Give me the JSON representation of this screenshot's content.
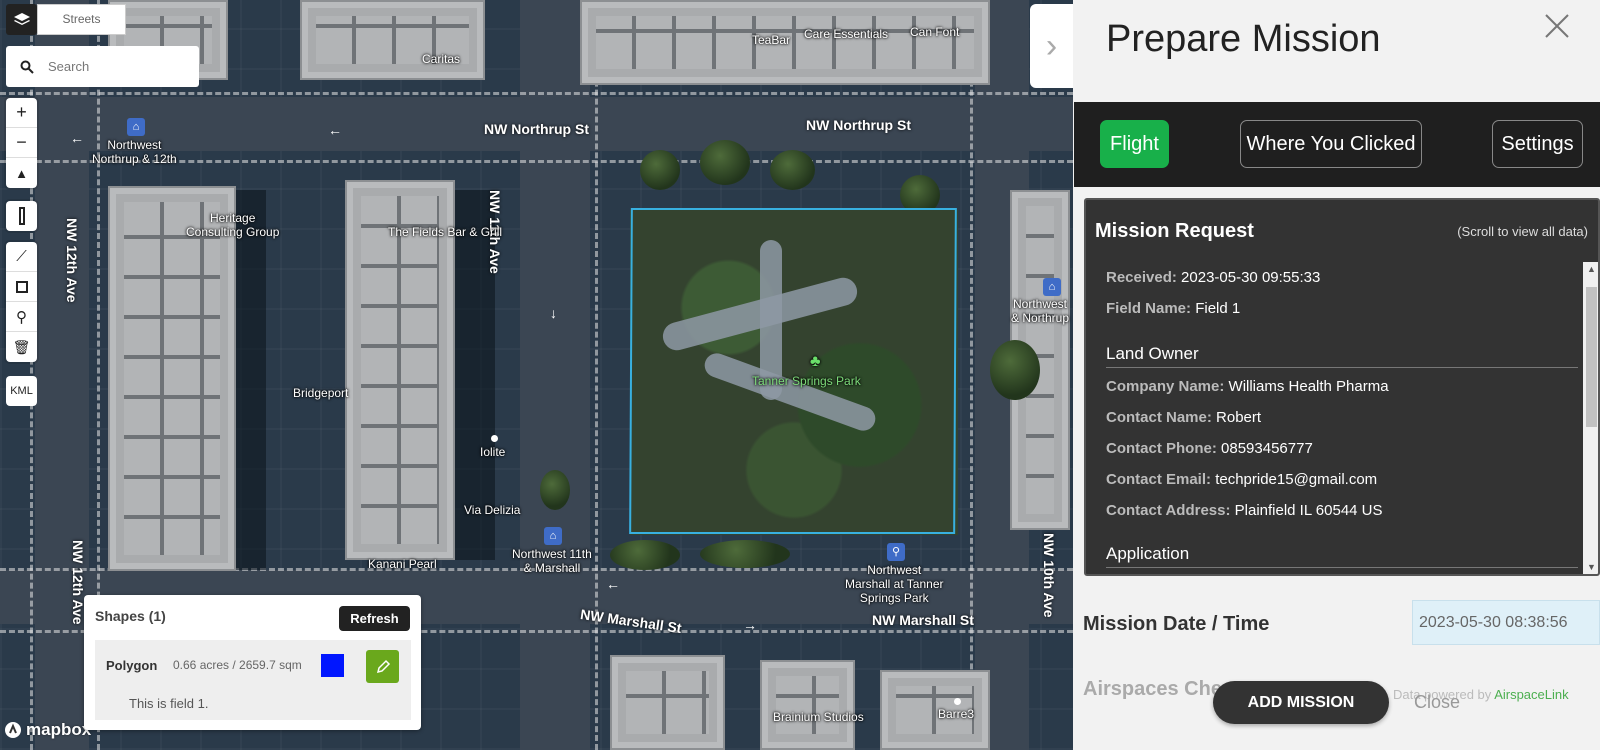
{
  "map": {
    "style_label": "Streets",
    "search_placeholder": "Search",
    "kml_label": "KML",
    "attribution": "mapbox",
    "streets": [
      "NW Northrup St",
      "NW Northrup St",
      "NW 11th Ave",
      "NW 12th Ave",
      "NW 12th Ave",
      "NW Marshall St",
      "NW Marshall St",
      "NW 10th Ave"
    ],
    "places": {
      "tea_bar": "TeaBar",
      "care_essentials": "Care Essentials",
      "can_font": "Can Font",
      "caritas": "Caritas",
      "northwest_northrup": "Northwest\nNorthrup & 12th",
      "heritage": "Heritage\nConsulting Group",
      "fields_bar": "The Fields Bar & Grill",
      "bridgeport": "Bridgeport",
      "iolite": "Iolite",
      "via_delizia": "Via Delizia",
      "kanani": "Kanani Pearl",
      "nw_11th_marshall": "Northwest 11th\n& Marshall",
      "tanner_park": "Tanner Springs Park",
      "nw_marshall_tanner": "Northwest\nMarshall at Tanner\nSprings Park",
      "nw_right": "Northwest\n& Northrup",
      "brainium": "Brainium Studios",
      "barre3": "Barre3"
    }
  },
  "shapes": {
    "title": "Shapes (1)",
    "refresh_label": "Refresh",
    "item": {
      "type": "Polygon",
      "size": "0.66 acres / 2659.7 sqm",
      "color": "#0016ff",
      "description": "This is field 1."
    }
  },
  "panel": {
    "title": "Prepare Mission",
    "tabs": [
      {
        "label": "Flight",
        "active": true
      },
      {
        "label": "Where You Clicked",
        "active": false
      },
      {
        "label": "Settings",
        "active": false
      }
    ],
    "mission_request": {
      "header": "Mission Request",
      "scroll_hint": "(Scroll to view all data)",
      "received_label": "Received:",
      "received_value": "2023-05-30 09:55:33",
      "field_label": "Field Name:",
      "field_value": "Field 1",
      "land_owner_header": "Land Owner",
      "company_label": "Company Name:",
      "company_value": "Williams Health Pharma",
      "contact_name_label": "Contact Name:",
      "contact_name_value": "Robert",
      "phone_label": "Contact Phone:",
      "phone_value": "08593456777",
      "email_label": "Contact Email:",
      "email_value": "techpride15@gmail.com",
      "address_label": "Contact Address:",
      "address_value": "Plainfield IL 60544 US",
      "application_header": "Application"
    },
    "date_label": "Mission Date / Time",
    "date_value": "2023-05-30 08:38:56",
    "airspace_label": "Airspaces Che",
    "powered_prefix": "Data powered by ",
    "powered_brand": "AirspaceLink",
    "add_mission_label": "ADD MISSION",
    "close_label": "Close"
  },
  "colors": {
    "active_tab": "#18b04a",
    "field_outline": "#38b0e0"
  }
}
